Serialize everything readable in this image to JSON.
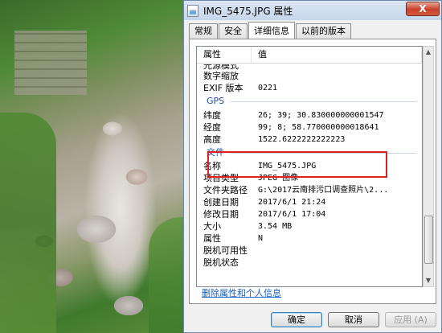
{
  "window": {
    "title": "IMG_5475.JPG 属性",
    "close_label": "X"
  },
  "tabs": [
    {
      "label": "常规"
    },
    {
      "label": "安全"
    },
    {
      "label": "详细信息"
    },
    {
      "label": "以前的版本"
    }
  ],
  "list": {
    "headers": {
      "name": "属性",
      "value": "值"
    },
    "rows_top": [
      {
        "name": "光源模式",
        "value": ""
      },
      {
        "name": "数字缩放",
        "value": ""
      },
      {
        "name": "EXIF 版本",
        "value": "0221"
      }
    ],
    "gps_group": "GPS",
    "gps": [
      {
        "name": "纬度",
        "value": "26; 39; 30.830000000001547"
      },
      {
        "name": "经度",
        "value": "99; 8; 58.770000000018641"
      },
      {
        "name": "高度",
        "value": "1522.6222222222223"
      }
    ],
    "file_group": "文件",
    "file": [
      {
        "name": "名称",
        "value": "IMG_5475.JPG"
      },
      {
        "name": "项目类型",
        "value": "JPEG 图像"
      },
      {
        "name": "文件夹路径",
        "value": "G:\\2017云南排污口调查照片\\2..."
      },
      {
        "name": "创建日期",
        "value": "2017/6/1 21:24"
      },
      {
        "name": "修改日期",
        "value": "2017/6/1 17:04"
      },
      {
        "name": "大小",
        "value": "3.54 MB"
      },
      {
        "name": "属性",
        "value": "N"
      },
      {
        "name": "脱机可用性",
        "value": ""
      },
      {
        "name": "脱机状态",
        "value": ""
      }
    ]
  },
  "remove_link": "删除属性和个人信息",
  "buttons": {
    "ok": "确定",
    "cancel": "取消",
    "apply": "应用 (A)"
  }
}
